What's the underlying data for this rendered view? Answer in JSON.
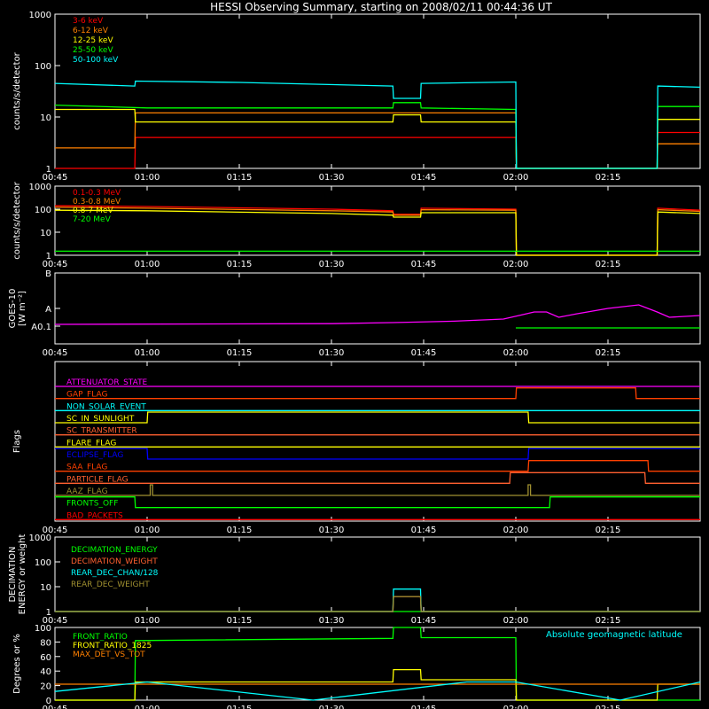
{
  "title": "HESSI Observing Summary, starting on 2008/02/11 00:44:36 UT",
  "colors": {
    "red": "#ff0000",
    "orange": "#ff8000",
    "yellow": "#ffff00",
    "green": "#00ff00",
    "cyan": "#00ffff",
    "magenta": "#ff00ff",
    "blue": "#0000ff",
    "olive": "#a09030",
    "salmon": "#ff6030",
    "white": "#ffffff"
  },
  "x_axis": {
    "tick_labels": [
      "00:45",
      "01:00",
      "01:15",
      "01:30",
      "01:45",
      "02:00",
      "02:15"
    ],
    "tick_minutes": [
      45,
      60,
      75,
      90,
      105,
      120,
      135
    ],
    "range_minutes": [
      45,
      150
    ]
  },
  "chart_data": [
    {
      "type": "line",
      "ylabel": "counts/s/detector",
      "yscale": "log",
      "ylim": [
        1,
        1000
      ],
      "ytick_labels": [
        "1",
        "10",
        "100",
        "1000"
      ],
      "legend_placement": "top-left",
      "series": [
        {
          "name": "3-6 keV",
          "color": "#ff0000",
          "x": [
            45,
            58,
            58.1,
            104,
            105,
            120,
            120.1,
            143,
            143.1,
            150
          ],
          "y": [
            1,
            1,
            4,
            4,
            4,
            4,
            1,
            1,
            5,
            5
          ]
        },
        {
          "name": "6-12 keV",
          "color": "#ff8000",
          "x": [
            45,
            58,
            58.1,
            104,
            105,
            120,
            120.1,
            143,
            143.1,
            150
          ],
          "y": [
            2.5,
            2.5,
            12,
            12,
            12,
            12,
            1,
            1,
            3,
            3
          ]
        },
        {
          "name": "12-25 keV",
          "color": "#ffff00",
          "x": [
            45,
            58,
            58.1,
            100,
            100.1,
            104.5,
            104.6,
            120,
            120.1,
            143,
            143.1,
            150
          ],
          "y": [
            14,
            14,
            8,
            8,
            11,
            11,
            8,
            8,
            1,
            1,
            9,
            9
          ]
        },
        {
          "name": "25-50 keV",
          "color": "#00ff00",
          "x": [
            45,
            60,
            100,
            100.1,
            104.5,
            104.6,
            120,
            120.1,
            143,
            143.1,
            150
          ],
          "y": [
            17,
            15,
            15,
            19,
            19,
            15,
            14,
            1,
            1,
            16,
            16
          ]
        },
        {
          "name": "50-100 keV",
          "color": "#00ffff",
          "x": [
            45,
            58,
            58.1,
            75,
            100,
            100.1,
            104.5,
            104.6,
            120,
            120.1,
            143,
            143.1,
            150
          ],
          "y": [
            45,
            40,
            50,
            47,
            40,
            23,
            23,
            45,
            48,
            1,
            1,
            40,
            38
          ]
        }
      ]
    },
    {
      "type": "line",
      "ylabel": "counts/s/detector",
      "yscale": "log",
      "ylim": [
        1,
        1000
      ],
      "ytick_labels": [
        "1",
        "10",
        "100",
        "1000"
      ],
      "legend_placement": "top-left",
      "series": [
        {
          "name": "0.1-0.3 MeV",
          "color": "#ff0000",
          "x": [
            45,
            60,
            90,
            100,
            100.1,
            104.5,
            104.6,
            120,
            120.1,
            143,
            143.1,
            150
          ],
          "y": [
            140,
            130,
            100,
            85,
            60,
            60,
            110,
            100,
            1,
            1,
            110,
            90
          ]
        },
        {
          "name": "0.3-0.8 MeV",
          "color": "#ff8000",
          "x": [
            45,
            60,
            90,
            100,
            100.1,
            104.5,
            104.6,
            120,
            120.1,
            143,
            143.1,
            150
          ],
          "y": [
            120,
            110,
            85,
            75,
            55,
            55,
            95,
            90,
            1,
            1,
            95,
            80
          ]
        },
        {
          "name": "0.8-7 MeV",
          "color": "#ffff00",
          "x": [
            45,
            60,
            90,
            100,
            100.1,
            104.5,
            104.6,
            120,
            120.1,
            143,
            143.1,
            150
          ],
          "y": [
            90,
            85,
            65,
            55,
            45,
            45,
            70,
            70,
            1,
            1,
            75,
            65
          ]
        },
        {
          "name": "7-20 MeV",
          "color": "#00ff00",
          "x": [
            45,
            150
          ],
          "y": [
            1.5,
            1.5
          ]
        }
      ]
    },
    {
      "type": "line",
      "ylabel": "GOES-10 [W m⁻²]",
      "ylim": [
        0,
        2
      ],
      "ytick_labels": [
        "A0.1",
        "A",
        "B"
      ],
      "series": [
        {
          "name": "",
          "color": "#ff00ff",
          "x": [
            45,
            90,
            100,
            110,
            118,
            121,
            123,
            125,
            127,
            130,
            135,
            140,
            143,
            145,
            150
          ],
          "y": [
            0.55,
            0.57,
            0.6,
            0.64,
            0.7,
            0.82,
            0.9,
            0.9,
            0.75,
            0.85,
            1.0,
            1.1,
            0.9,
            0.75,
            0.8
          ]
        },
        {
          "name": "",
          "color": "#00ff00",
          "x": [
            120,
            150
          ],
          "y": [
            0.45,
            0.45
          ]
        }
      ]
    },
    {
      "type": "line",
      "ylabel": "Flags",
      "flags": [
        {
          "name": "ATTENUATOR_STATE",
          "color": "#ff00ff",
          "x": [
            45,
            150
          ],
          "y": [
            0,
            0
          ]
        },
        {
          "name": "GAP_FLAG",
          "color": "#ff4000",
          "x": [
            45,
            120,
            120.1,
            139.5,
            139.6,
            150
          ],
          "y": [
            0,
            0,
            1,
            1,
            0,
            0
          ]
        },
        {
          "name": "NON_SOLAR_EVENT",
          "color": "#00ffff",
          "x": [
            45,
            150
          ],
          "y": [
            0,
            0
          ]
        },
        {
          "name": "SC_IN_SUNLIGHT",
          "color": "#ffff00",
          "x": [
            45,
            60,
            60.1,
            122,
            122.1,
            150
          ],
          "y": [
            0,
            0,
            1,
            1,
            0,
            0
          ]
        },
        {
          "name": "SC_TRANSMITTER",
          "color": "#ff6030",
          "x": [
            45,
            150
          ],
          "y": [
            0,
            0
          ]
        },
        {
          "name": "FLARE_FLAG",
          "color": "#ffff00",
          "x": [
            45,
            150
          ],
          "y": [
            0,
            0
          ]
        },
        {
          "name": "ECLIPSE_FLAG",
          "color": "#0000ff",
          "x": [
            45,
            60,
            60.1,
            122,
            122.1,
            150
          ],
          "y": [
            1,
            1,
            0,
            0,
            1,
            1
          ]
        },
        {
          "name": "SAA_FLAG",
          "color": "#ff4000",
          "x": [
            45,
            122,
            122.1,
            141.5,
            141.6,
            150
          ],
          "y": [
            0,
            0,
            1,
            1,
            0,
            0
          ]
        },
        {
          "name": "PARTICLE_FLAG",
          "color": "#ff6030",
          "x": [
            45,
            119,
            119.1,
            141,
            141.1,
            150
          ],
          "y": [
            0,
            0,
            1,
            1,
            0,
            0
          ]
        },
        {
          "name": "AAZ_FLAG",
          "color": "#a09030",
          "x": [
            45,
            60.5,
            60.5,
            60.9,
            60.9,
            122,
            122,
            122.4,
            122.4,
            150
          ],
          "y": [
            0,
            0,
            1,
            1,
            0,
            0,
            1,
            1,
            0,
            0
          ]
        },
        {
          "name": "FRONTS_OFF",
          "color": "#00ff00",
          "x": [
            45,
            58,
            58.1,
            125.5,
            125.6,
            150
          ],
          "y": [
            1,
            1,
            0,
            0,
            1,
            1
          ]
        },
        {
          "name": "BAD_PACKETS",
          "color": "#ff0000",
          "x": [
            45,
            150
          ],
          "y": [
            0,
            0
          ]
        }
      ]
    },
    {
      "type": "line",
      "ylabel": "DECIMATION ENERGY or weight",
      "yscale": "log",
      "ylim": [
        1,
        1000
      ],
      "ytick_labels": [
        "1",
        "10",
        "100",
        "1000"
      ],
      "legend_placement": "top-left",
      "series": [
        {
          "name": "DECIMATION_ENERGY",
          "color": "#00ff00",
          "x": [
            45,
            150
          ],
          "y": [
            1,
            1
          ]
        },
        {
          "name": "DECIMATION_WEIGHT",
          "color": "#ff6030",
          "x": [
            45,
            100,
            100.1,
            104.5,
            104.6,
            150
          ],
          "y": [
            1,
            1,
            4,
            4,
            1,
            1
          ]
        },
        {
          "name": "REAR_DEC_CHAN/128",
          "color": "#00ffff",
          "x": [
            45,
            100,
            100.1,
            104.5,
            104.6,
            150
          ],
          "y": [
            1,
            1,
            8,
            8,
            1,
            1
          ]
        },
        {
          "name": "REAR_DEC_WEIGHT",
          "color": "#a09030",
          "x": [
            45,
            100,
            100.1,
            104.5,
            104.6,
            150
          ],
          "y": [
            1,
            1,
            4,
            4,
            1,
            1
          ]
        }
      ]
    },
    {
      "type": "line",
      "ylabel": "Degrees or %",
      "ylim": [
        0,
        100
      ],
      "ytick_labels": [
        "0",
        "20",
        "40",
        "60",
        "80",
        "100"
      ],
      "legend_placement": "top-left",
      "annotation": "Absolute geomagnetic latitude",
      "series": [
        {
          "name": "FRONT_RATIO",
          "color": "#00ff00",
          "x": [
            45,
            58,
            58.1,
            100,
            100.1,
            104.5,
            104.6,
            120,
            120.1,
            143,
            143.1,
            150
          ],
          "y": [
            0,
            0,
            82,
            85,
            100,
            100,
            86,
            86,
            0,
            0,
            0,
            0
          ]
        },
        {
          "name": "FRONT_RATIO_1825",
          "color": "#ffff00",
          "x": [
            45,
            58,
            58.1,
            100,
            100.1,
            104.5,
            104.6,
            120,
            120.1,
            143,
            143.1,
            150
          ],
          "y": [
            0,
            0,
            25,
            25,
            42,
            42,
            28,
            28,
            0,
            0,
            22,
            22
          ]
        },
        {
          "name": "MAX_DET_VS_TOT",
          "color": "#ff8000",
          "x": [
            45,
            150
          ],
          "y": [
            22,
            22
          ]
        },
        {
          "name": "",
          "color": "#00ffff",
          "x": [
            45,
            60,
            87,
            112,
            120,
            137,
            150
          ],
          "y": [
            12,
            25,
            0,
            25,
            25,
            0,
            25
          ]
        }
      ]
    }
  ]
}
